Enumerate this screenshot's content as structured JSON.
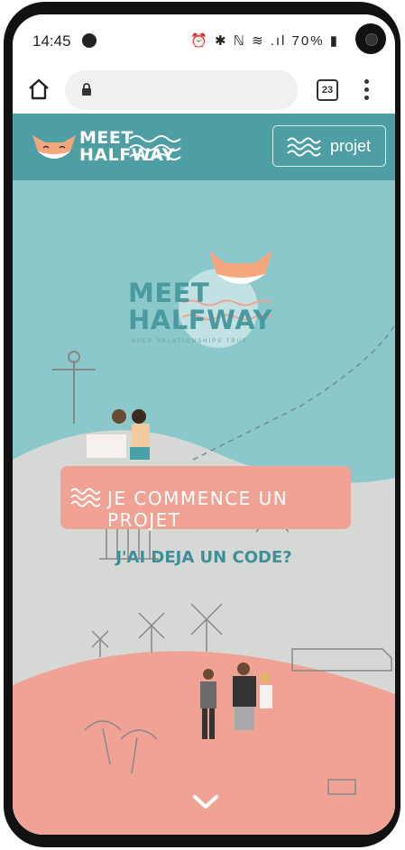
{
  "status_bar": {
    "time": "14:45",
    "icons": "⏰ ✱ ℕ ≋ .ıl",
    "battery": "70%"
  },
  "browser": {
    "tab_count": "23"
  },
  "site_header": {
    "brand_line1": "MEET",
    "brand_line2": "HALFWAY",
    "projet_label": "projet"
  },
  "hero": {
    "logo_line1": "MEET",
    "logo_line2": "HALFWAY",
    "logo_sub": "KEEP RELATIONSHIPS TRUE",
    "cta_label": "JE COMMENCE UN PROJET",
    "code_link": "J'AI DEJA UN CODE?"
  },
  "colors": {
    "teal_header": "#4e9fa4",
    "sky": "#8ac8cb",
    "coral": "#f0a394",
    "hill_grey": "#d6d8d5"
  },
  "icons": [
    "home-icon",
    "lock-icon",
    "tabs-icon",
    "more-vert-icon",
    "fox-icon",
    "waves-icon",
    "chevron-down-icon"
  ]
}
